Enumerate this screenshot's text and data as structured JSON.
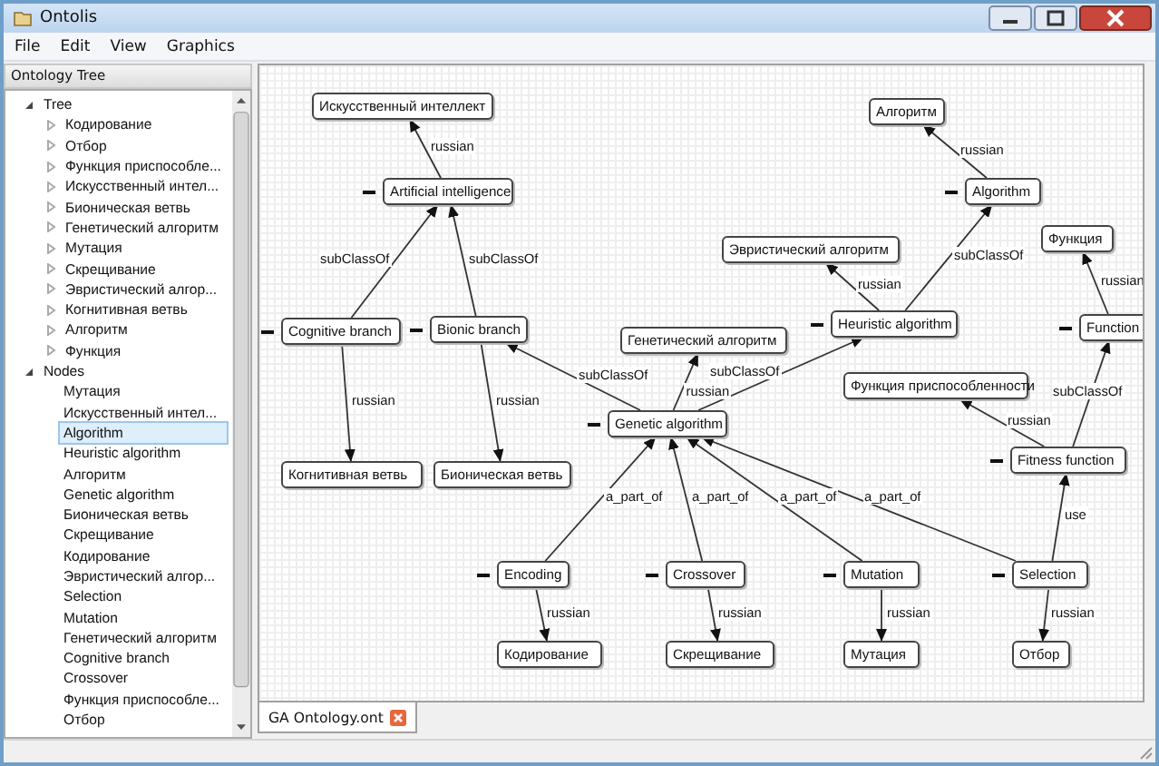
{
  "window": {
    "title": "Ontolis"
  },
  "menu": [
    "File",
    "Edit",
    "View",
    "Graphics"
  ],
  "sidebar": {
    "title": "Ontology Tree",
    "tree": [
      {
        "label": "Tree",
        "expanded": true,
        "children": [
          {
            "label": "Кодирование",
            "expanded": false
          },
          {
            "label": "Отбор",
            "expanded": false
          },
          {
            "label": "Функция приспособле...",
            "expanded": false
          },
          {
            "label": "Искусственный интел...",
            "expanded": false
          },
          {
            "label": "Бионическая ветвь",
            "expanded": false
          },
          {
            "label": "Генетический алгоритм",
            "expanded": false
          },
          {
            "label": "Мутация",
            "expanded": false
          },
          {
            "label": "Скрещивание",
            "expanded": false
          },
          {
            "label": "Эвристический алгор...",
            "expanded": false
          },
          {
            "label": "Когнитивная ветвь",
            "expanded": false
          },
          {
            "label": "Алгоритм",
            "expanded": false
          },
          {
            "label": "Функция",
            "expanded": false
          }
        ]
      },
      {
        "label": "Nodes",
        "expanded": true,
        "items": [
          {
            "label": "Мутация",
            "selected": false
          },
          {
            "label": "Искусственный интел...",
            "selected": false
          },
          {
            "label": "Algorithm",
            "selected": true
          },
          {
            "label": "Heuristic algorithm",
            "selected": false
          },
          {
            "label": "Алгоритм",
            "selected": false
          },
          {
            "label": "Genetic algorithm",
            "selected": false
          },
          {
            "label": "Бионическая ветвь",
            "selected": false
          },
          {
            "label": "Скрещивание",
            "selected": false
          },
          {
            "label": "Кодирование",
            "selected": false
          },
          {
            "label": "Эвристический алгор...",
            "selected": false
          },
          {
            "label": "Selection",
            "selected": false
          },
          {
            "label": "Mutation",
            "selected": false
          },
          {
            "label": "Генетический алгоритм",
            "selected": false
          },
          {
            "label": "Cognitive branch",
            "selected": false
          },
          {
            "label": "Crossover",
            "selected": false
          },
          {
            "label": "Функция приспособле...",
            "selected": false
          },
          {
            "label": "Отбор",
            "selected": false
          }
        ]
      }
    ]
  },
  "graph": {
    "nodes": [
      {
        "label": "Искусственный интеллект",
        "collapsible": false
      },
      {
        "label": "Алгоритм",
        "collapsible": false
      },
      {
        "label": "Artificial intelligence",
        "collapsible": true
      },
      {
        "label": "Algorithm",
        "collapsible": true
      },
      {
        "label": "Функция",
        "collapsible": false
      },
      {
        "label": "Эвристический алгоритм",
        "collapsible": false
      },
      {
        "label": "Cognitive branch",
        "collapsible": true
      },
      {
        "label": "Bionic branch",
        "collapsible": true
      },
      {
        "label": "Heuristic algorithm",
        "collapsible": true
      },
      {
        "label": "Function",
        "collapsible": true
      },
      {
        "label": "Генетический алгоритм",
        "collapsible": false
      },
      {
        "label": "Функция приспособленности",
        "collapsible": false
      },
      {
        "label": "Genetic algorithm",
        "collapsible": true
      },
      {
        "label": "Fitness function",
        "collapsible": true
      },
      {
        "label": "Когнитивная ветвь",
        "collapsible": false
      },
      {
        "label": "Бионическая ветвь",
        "collapsible": false
      },
      {
        "label": "Encoding",
        "collapsible": true
      },
      {
        "label": "Crossover",
        "collapsible": true
      },
      {
        "label": "Mutation",
        "collapsible": true
      },
      {
        "label": "Selection",
        "collapsible": true
      },
      {
        "label": "Кодирование",
        "collapsible": false
      },
      {
        "label": "Скрещивание",
        "collapsible": false
      },
      {
        "label": "Мутация",
        "collapsible": false
      },
      {
        "label": "Отбор",
        "collapsible": false
      }
    ],
    "edges": [
      {
        "label": "russian"
      },
      {
        "label": "russian"
      },
      {
        "label": "subClassOf"
      },
      {
        "label": "subClassOf"
      },
      {
        "label": "subClassOf"
      },
      {
        "label": "russian"
      },
      {
        "label": "russian"
      },
      {
        "label": "subClassOf"
      },
      {
        "label": "russian"
      },
      {
        "label": "subClassOf"
      },
      {
        "label": "russian"
      },
      {
        "label": "russian"
      },
      {
        "label": "subClassOf"
      },
      {
        "label": "russian"
      },
      {
        "label": "a_part_of"
      },
      {
        "label": "a_part_of"
      },
      {
        "label": "a_part_of"
      },
      {
        "label": "a_part_of"
      },
      {
        "label": "use"
      },
      {
        "label": "russian"
      },
      {
        "label": "russian"
      },
      {
        "label": "russian"
      },
      {
        "label": "russian"
      }
    ]
  },
  "tabs": [
    {
      "label": "GA Ontology.ont",
      "selected": true
    }
  ]
}
